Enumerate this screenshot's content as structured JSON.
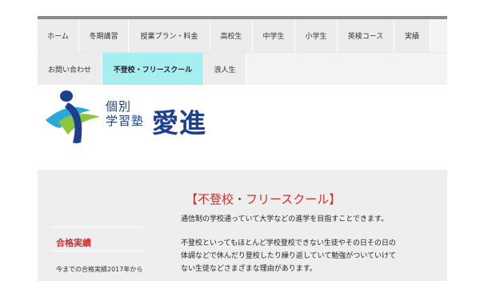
{
  "nav": {
    "row1": [
      "ホーム",
      "冬期講習",
      "授業プラン・料金",
      "高校生",
      "中学生",
      "小学生",
      "英検コース",
      "実績"
    ],
    "row2": [
      "お問い合わせ",
      "不登校・フリースクール",
      "浪人生"
    ]
  },
  "logo": {
    "small_line1": "個別",
    "small_line2": "学習塾",
    "big": "愛進"
  },
  "sidebar": {
    "heading": "合格実績",
    "text": "今までの合格実績2017年から"
  },
  "content": {
    "title": "【不登校・フリースクール】",
    "p1": "通信制の学校通っていて大学などの進学を目指すことできます。",
    "p2_line1": "不登校といってもほとんど学校登校できない生徒やその日その日の",
    "p2_line2": "体調などで休んだり登校したり繰り返していて勉強がついていけて",
    "p2_line3": "ない生徒などさまざまな理由があります。"
  },
  "colors": {
    "accent": "#d0312d",
    "active_tab": "#a6eef0",
    "brand": "#1d3f8f"
  }
}
